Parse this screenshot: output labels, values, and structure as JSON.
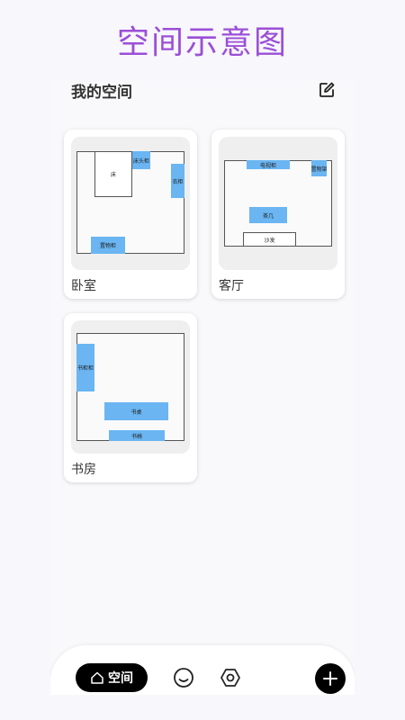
{
  "app_title": "空间示意图",
  "header": {
    "title": "我的空间"
  },
  "rooms": [
    {
      "name": "卧室",
      "furniture": [
        {
          "label": "床"
        },
        {
          "label": "床头柜"
        },
        {
          "label": "衣柜"
        },
        {
          "label": "置物柜"
        }
      ]
    },
    {
      "name": "客厅",
      "furniture": [
        {
          "label": "电视柜"
        },
        {
          "label": "置物架"
        },
        {
          "label": "茶几"
        },
        {
          "label": "沙发"
        }
      ]
    },
    {
      "name": "书房",
      "furniture": [
        {
          "label": "书柜柜"
        },
        {
          "label": "书桌"
        },
        {
          "label": "书椅"
        }
      ]
    }
  ],
  "nav": {
    "home_label": "空间"
  },
  "colors": {
    "accent": "#9b4fd6",
    "furniture": "#6ab5f2"
  }
}
